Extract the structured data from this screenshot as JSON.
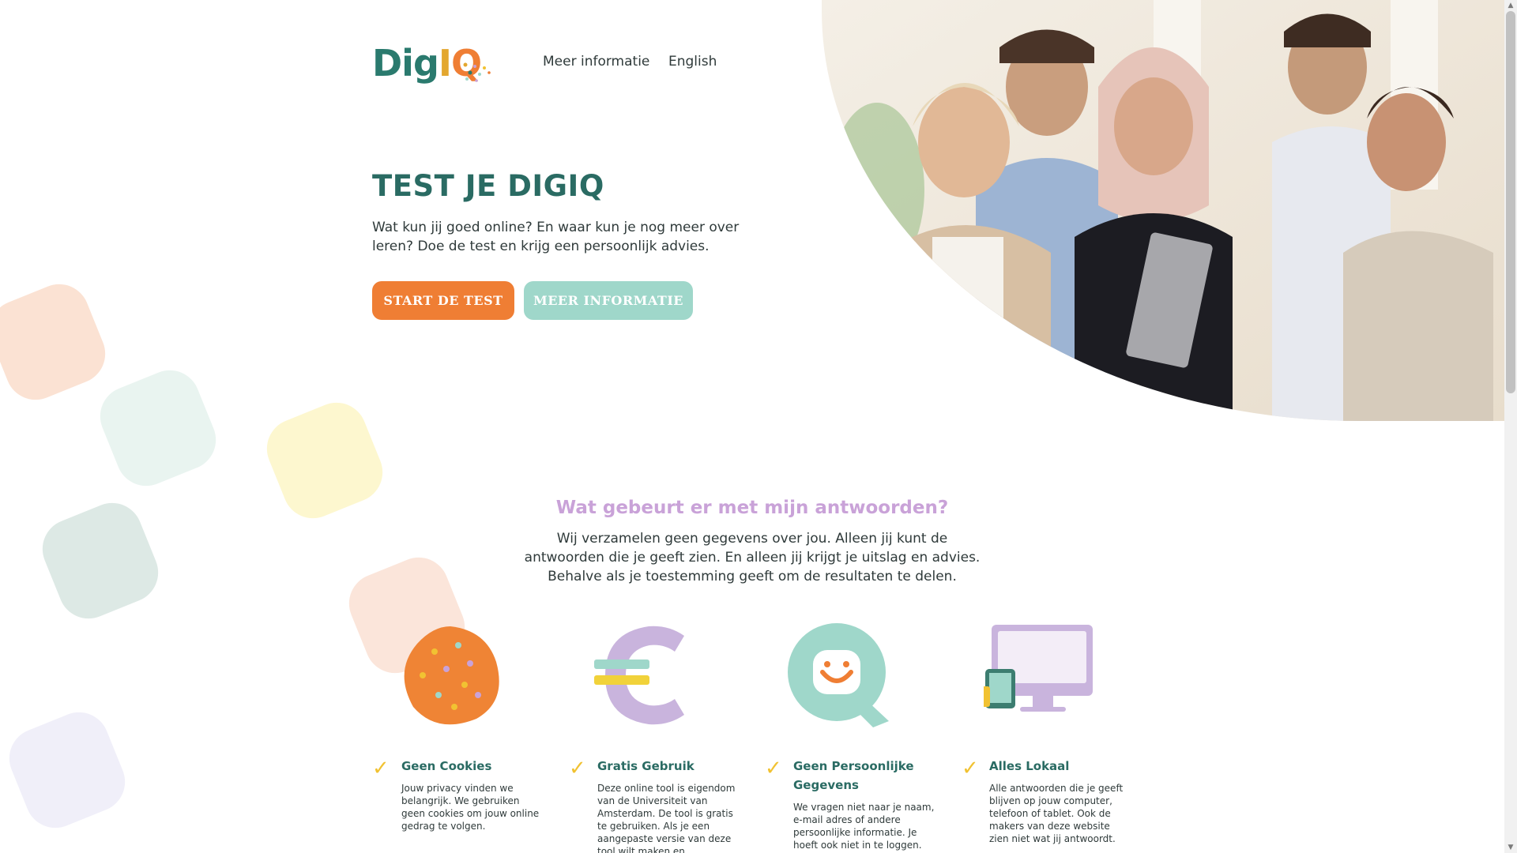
{
  "header": {
    "logo_text_di": "Dig",
    "logo_text_i": "I",
    "logo_text_q": "Q",
    "nav": [
      "Meer informatie",
      "English"
    ]
  },
  "hero": {
    "title": "TEST JE DIGIQ",
    "text": "Wat kun jij goed online? En waar kun je nog meer over leren? Doe de test en krijg een persoonlijk advies.",
    "start_button": "START DE TEST",
    "more_button": "MEER INFORMATIE"
  },
  "privacy": {
    "title": "Wat gebeurt er met mijn antwoorden?",
    "text": "Wij verzamelen geen gegevens over jou. Alleen jij kunt de antwoorden die je geeft zien. En alleen jij krijgt je uitslag en advies. Behalve als je toestemming geeft om de resultaten te delen."
  },
  "features": [
    {
      "icon": "cookie-icon",
      "title": "Geen Cookies",
      "text": "Jouw privacy vinden we belangrijk. We gebruiken geen cookies om jouw online gedrag te volgen."
    },
    {
      "icon": "euro-icon",
      "title": "Gratis Gebruik",
      "text": "Deze online tool is eigendom van de Universiteit van Amsterdam. De tool is gratis te gebruiken. Als je een aangepaste versie van deze tool wilt maken en"
    },
    {
      "icon": "smiley-q-icon",
      "title": "Geen Persoonlijke Gegevens",
      "text": "We vragen niet naar je naam, e-mail adres of andere persoonlijke informatie. Je hoeft ook niet in te loggen."
    },
    {
      "icon": "devices-icon",
      "title": "Alles Lokaal",
      "text": "Alle antwoorden die je geeft blijven op jouw computer, telefoon of tablet. Ook de makers van deze website zien niet wat jij antwoordt."
    }
  ],
  "colors": {
    "brand_green": "#2a6b63",
    "brand_orange": "#ef7e34",
    "mint": "#9fd7ca",
    "lavender": "#c9a2d8",
    "yellow": "#f1c232"
  }
}
